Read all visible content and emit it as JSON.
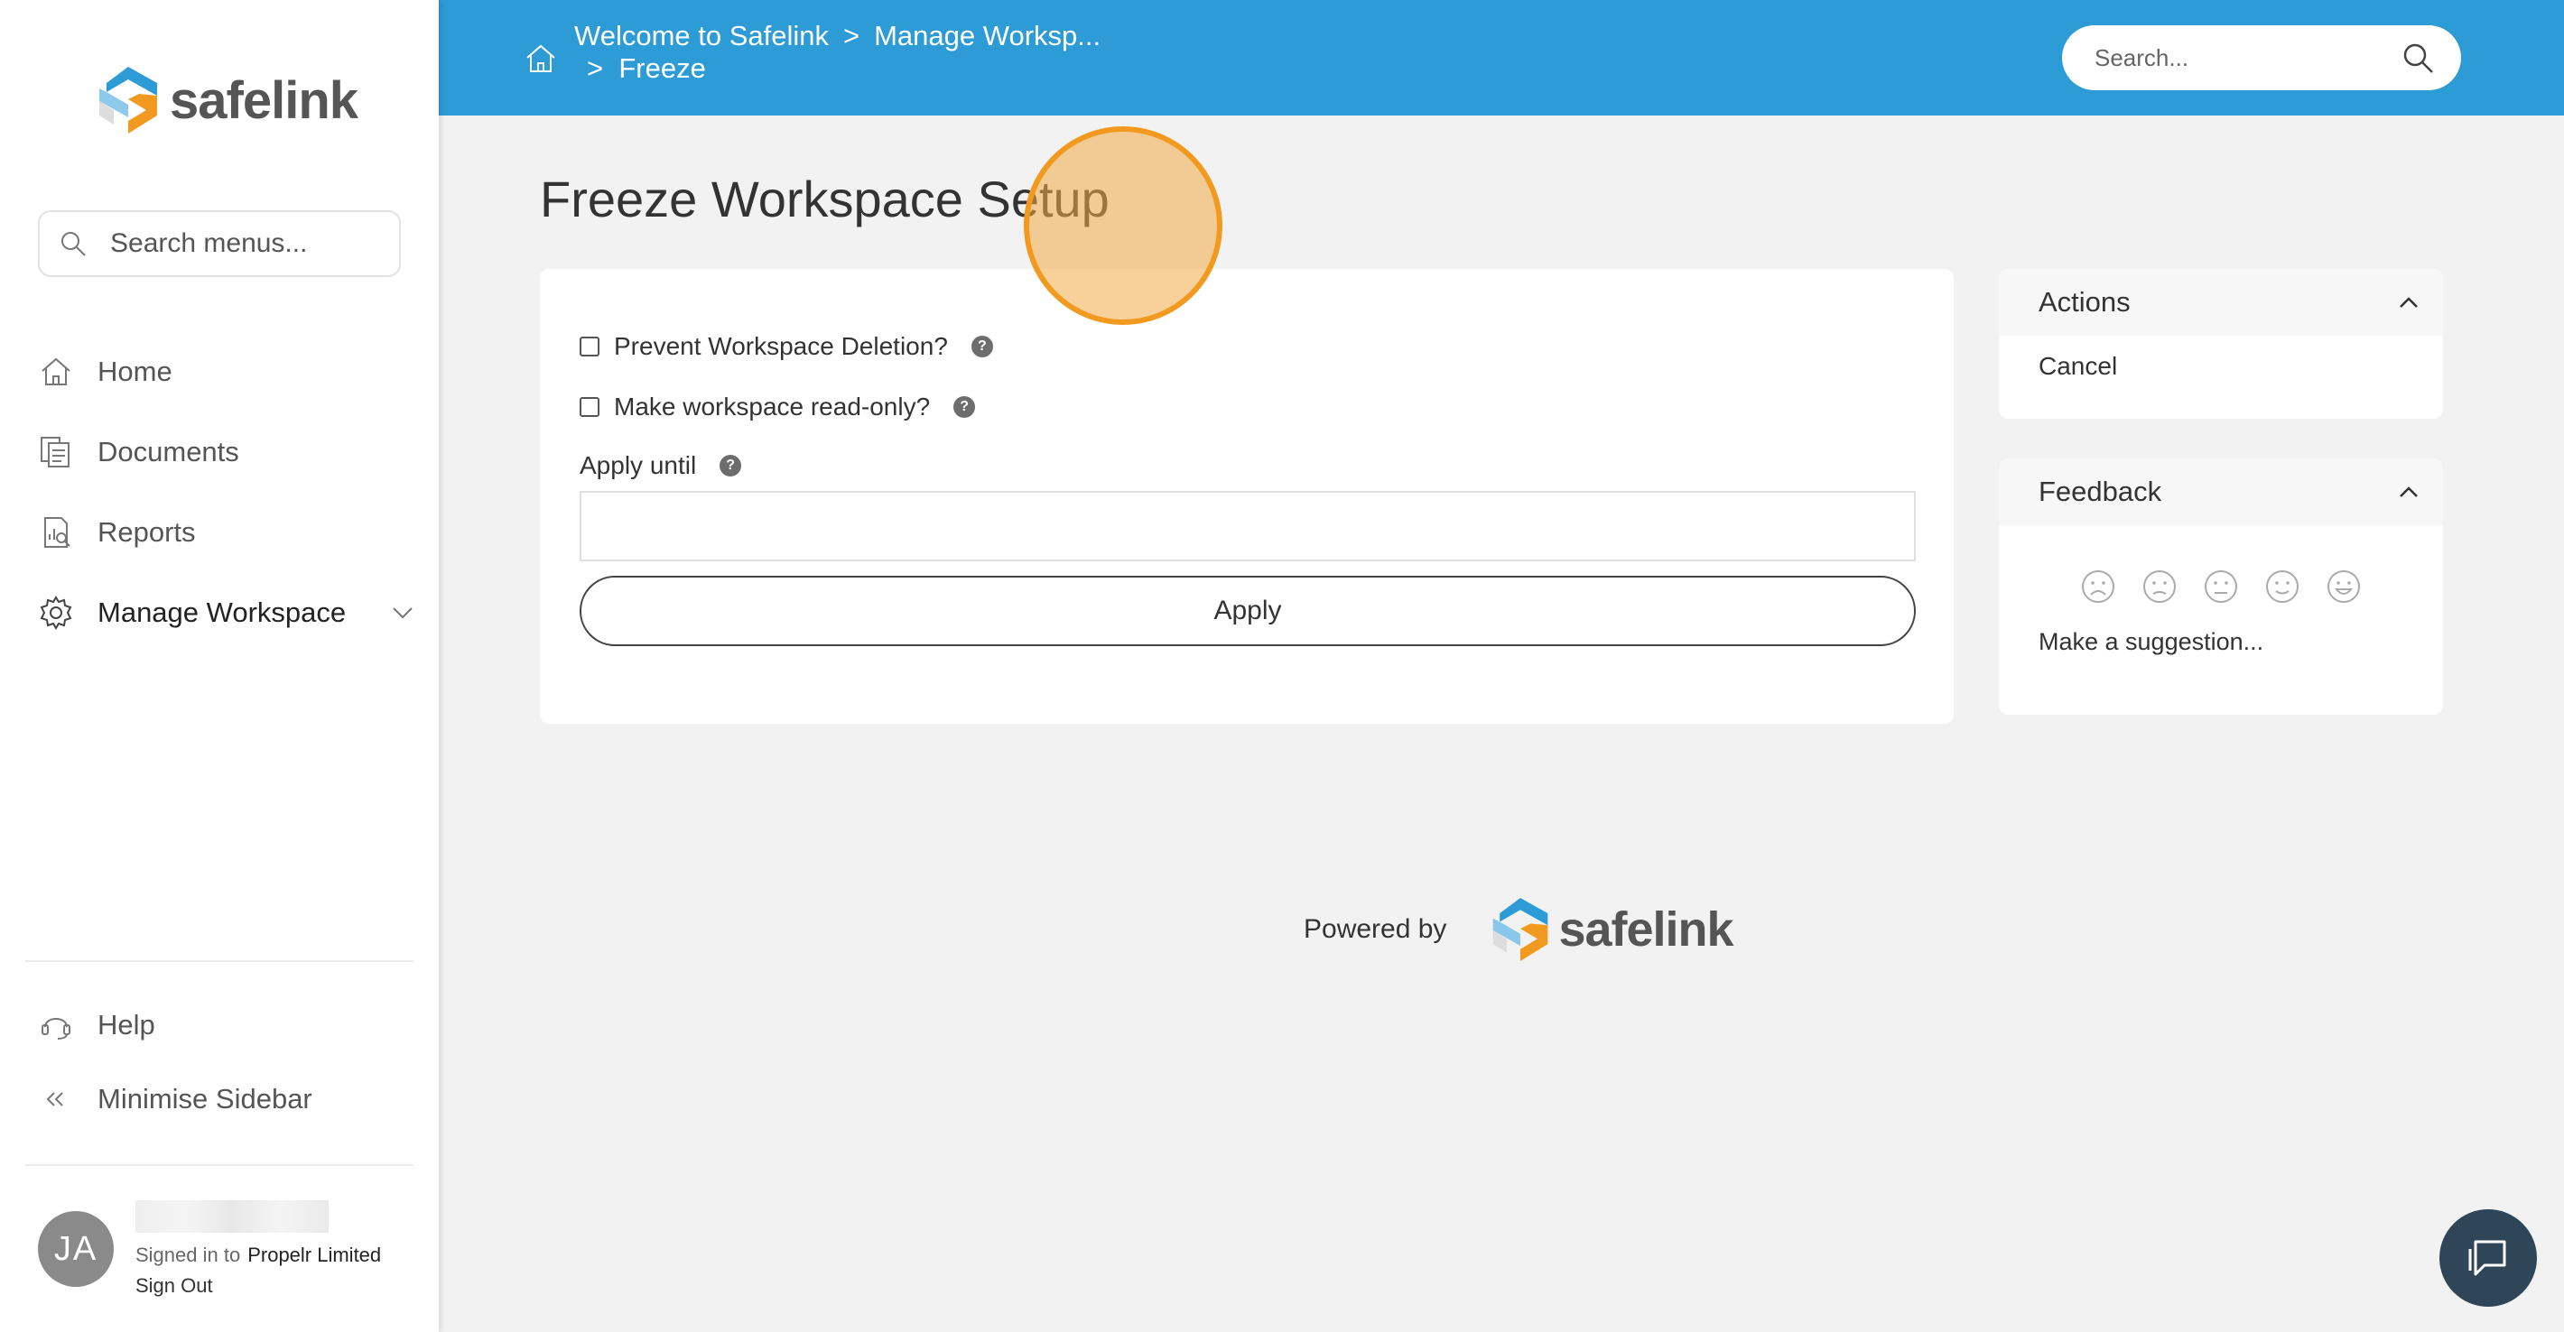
{
  "brand": {
    "name": "safelink",
    "colors": {
      "blue": "#2d9bd6",
      "orange": "#f29a20",
      "dark": "#555555"
    }
  },
  "sidebar": {
    "search_placeholder": "Search menus...",
    "items": [
      {
        "label": "Home",
        "icon": "home-icon"
      },
      {
        "label": "Documents",
        "icon": "documents-icon"
      },
      {
        "label": "Reports",
        "icon": "reports-icon"
      },
      {
        "label": "Manage Workspace",
        "icon": "gear-icon"
      }
    ],
    "footer": [
      {
        "label": "Help",
        "icon": "headset-icon"
      },
      {
        "label": "Minimise Sidebar",
        "icon": "double-chevron-left-icon"
      }
    ],
    "user": {
      "initials": "JA",
      "signed_in_prefix": "Signed in to",
      "organization": "Propelr Limited",
      "sign_out": "Sign Out"
    }
  },
  "header": {
    "breadcrumb": [
      "Welcome to Safelink",
      "Manage Worksp...",
      "Freeze"
    ],
    "separator": ">",
    "search_placeholder": "Search..."
  },
  "main": {
    "title": "Freeze Workspace Setup",
    "form": {
      "prevent_deletion_label": "Prevent Workspace Deletion?",
      "read_only_label": "Make workspace read-only?",
      "apply_until_label": "Apply until",
      "apply_until_value": "",
      "apply_button": "Apply"
    }
  },
  "actions_panel": {
    "title": "Actions",
    "items": [
      "Cancel"
    ]
  },
  "feedback_panel": {
    "title": "Feedback",
    "faces": [
      "very-sad-face-icon",
      "sad-face-icon",
      "neutral-face-icon",
      "smile-face-icon",
      "happy-face-icon"
    ],
    "suggestion": "Make a suggestion..."
  },
  "footer": {
    "powered_by": "Powered by"
  }
}
